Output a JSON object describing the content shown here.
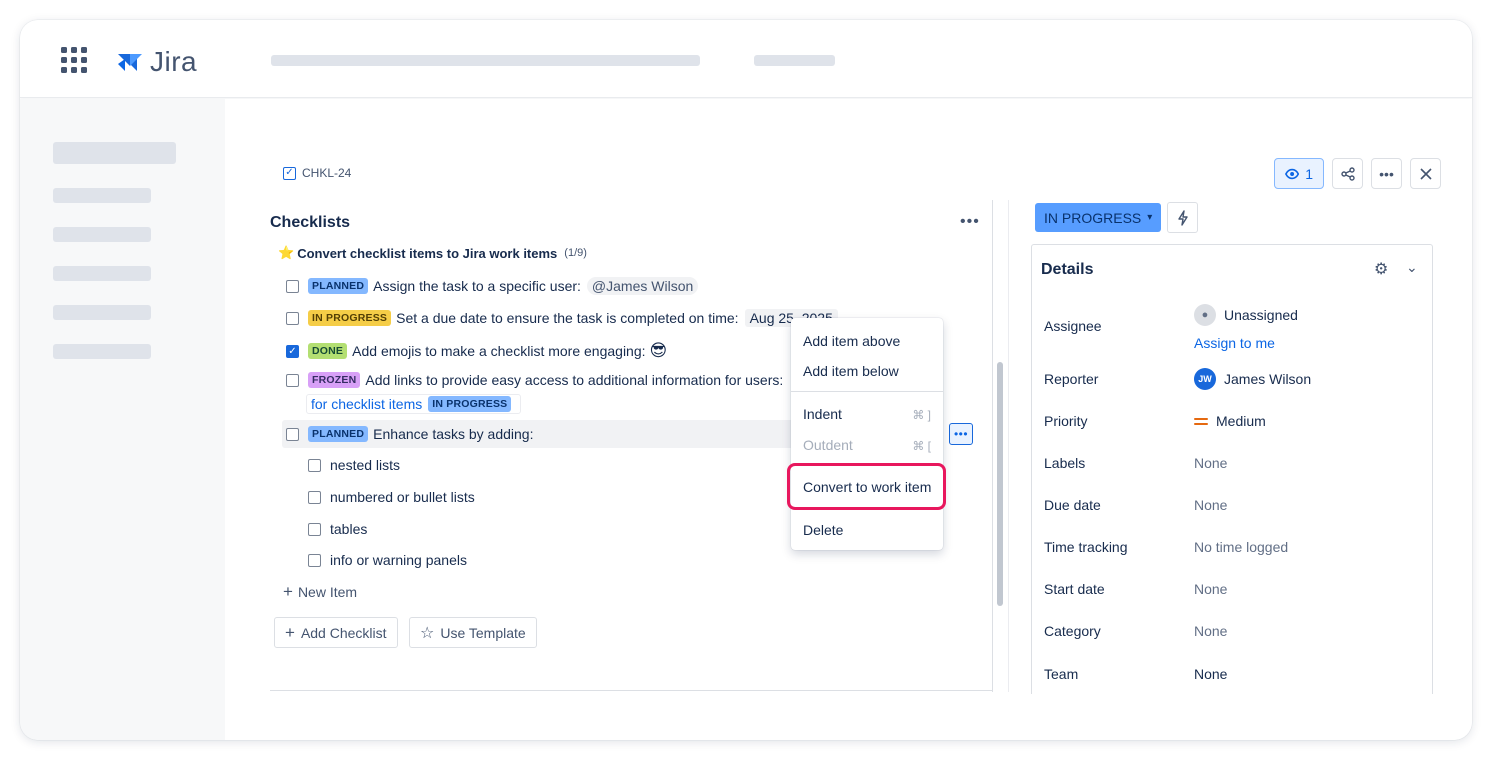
{
  "app": {
    "name": "Jira"
  },
  "issue": {
    "key": "CHKL-24"
  },
  "top_actions": {
    "watch_count": "1"
  },
  "checklists": {
    "title": "Checklists",
    "heading": "Convert checklist items to Jira work items",
    "count": "(1/9)",
    "items": [
      {
        "status": "PLANNED",
        "text": "Assign the task to a specific user:",
        "mention": "@James Wilson",
        "checked": false
      },
      {
        "status": "IN PROGRESS",
        "text": "Set a due date to ensure the task is completed on time:",
        "date": "Aug 25, 2025",
        "checked": false
      },
      {
        "status": "DONE",
        "text": "Add emojis to make a checklist more engaging:",
        "emoji": "😎",
        "checked": true
      },
      {
        "status": "FROZEN",
        "text": "Add links to provide easy access to additional information for users:",
        "link_text": "for checklist items",
        "link_status": "IN PROGRESS",
        "checked": false
      },
      {
        "status": "PLANNED",
        "text": "Enhance tasks by adding:",
        "checked": false
      }
    ],
    "subitems": [
      "nested lists",
      "numbered or bullet lists",
      "tables",
      "info or warning panels"
    ],
    "new_item": "New Item",
    "add_checklist": "Add Checklist",
    "use_template": "Use Template"
  },
  "context_menu": {
    "add_above": "Add item above",
    "add_below": "Add item below",
    "indent": "Indent",
    "indent_shortcut": "⌘ ]",
    "outdent": "Outdent",
    "outdent_shortcut": "⌘ [",
    "convert": "Convert to work item",
    "delete": "Delete"
  },
  "status_button": {
    "label": "IN PROGRESS"
  },
  "details": {
    "title": "Details",
    "assignee_label": "Assignee",
    "assignee_value": "Unassigned",
    "assign_to_me": "Assign to me",
    "reporter_label": "Reporter",
    "reporter_initials": "JW",
    "reporter_value": "James Wilson",
    "priority_label": "Priority",
    "priority_value": "Medium",
    "labels_label": "Labels",
    "labels_value": "None",
    "due_label": "Due date",
    "due_value": "None",
    "time_label": "Time tracking",
    "time_value": "No time logged",
    "start_label": "Start date",
    "start_value": "None",
    "category_label": "Category",
    "category_value": "None",
    "team_label": "Team",
    "team_value": "None"
  },
  "colors": {
    "accent": "#1868db",
    "highlight": "#e8175d",
    "status_blue": "#579dff"
  }
}
